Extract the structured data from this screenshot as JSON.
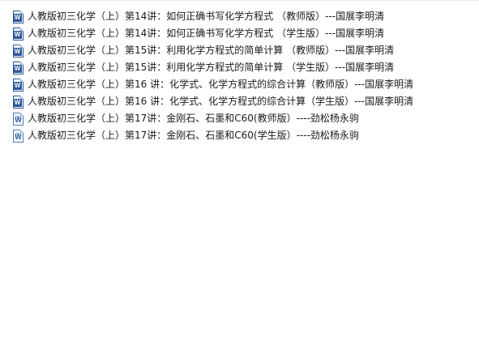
{
  "files": [
    {
      "name": "人教版初三化学（上）第14讲：如何正确书写化学方程式 （教师版）---国展李明清",
      "icon": "word-docx-icon"
    },
    {
      "name": "人教版初三化学（上）第14讲：如何正确书写化学方程式 （学生版）---国展李明清",
      "icon": "word-docx-icon"
    },
    {
      "name": "人教版初三化学（上）第15讲：利用化学方程式的简单计算 （教师版）---国展李明清",
      "icon": "word-docx-icon"
    },
    {
      "name": "人教版初三化学（上）第15讲：利用化学方程式的简单计算 （学生版）---国展李明清",
      "icon": "word-docx-icon"
    },
    {
      "name": "人教版初三化学（上）第16 讲：化学式、化学方程式的综合计算（教师版）---国展李明清",
      "icon": "word-docx-icon"
    },
    {
      "name": "人教版初三化学（上）第16 讲：化学式、化学方程式的综合计算（学生版）---国展李明清",
      "icon": "word-docx-icon"
    },
    {
      "name": "人教版初三化学（上）第17讲：金刚石、石墨和C60(教师版）----劲松杨永驹",
      "icon": "word-doc-icon"
    },
    {
      "name": "人教版初三化学（上）第17讲：金刚石、石墨和C60(学生版）----劲松杨永驹",
      "icon": "word-doc-icon"
    }
  ]
}
